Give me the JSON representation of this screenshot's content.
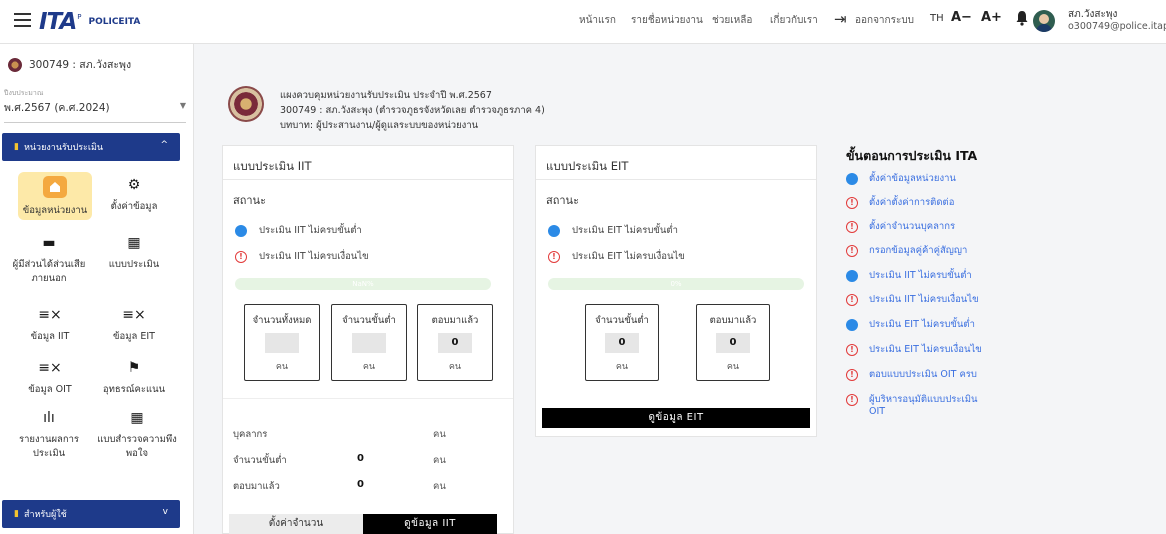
{
  "header": {
    "logo_mark": "ITA",
    "logo_reg": "P",
    "logo_text": "POLICEITA",
    "nav": [
      "หน้าแรก",
      "รายชื่อหน่วยงาน",
      "ช่วยเหลือ",
      "เกี่ยวกับเรา"
    ],
    "logout_label": "ออกจากระบบ",
    "logout_icon": "logout-icon",
    "lang": "TH",
    "font_decrease": "A−",
    "font_increase": "A+",
    "user_name": "สภ.วังสะพุง",
    "user_email": "o300749@police.itap"
  },
  "sidebar": {
    "org": "300749 : สภ.วังสะพุง",
    "year_label": "ปีงบประมาณ",
    "year_value": "พ.ศ.2567 (ค.ศ.2024)",
    "section1": "หน่วยงานรับประเมิน",
    "section2": "สำหรับผู้ใช้",
    "items": [
      {
        "label": "ข้อมูลหน่วยงาน",
        "icon": "home-icon"
      },
      {
        "label": "ตั้งค่าข้อมูล",
        "icon": "settings-icon"
      },
      {
        "label": "ผู้มีส่วนได้ส่วนเสียภายนอก",
        "icon": "store-icon"
      },
      {
        "label": "แบบประเมิน",
        "icon": "qr-icon"
      },
      {
        "label": "ข้อมูล IIT",
        "icon": "list-x-icon"
      },
      {
        "label": "ข้อมูล EIT",
        "icon": "list-x-icon"
      },
      {
        "label": "ข้อมูล OIT",
        "icon": "list-x-icon"
      },
      {
        "label": "อุทธรณ์คะแนน",
        "icon": "flag-icon"
      },
      {
        "label": "รายงานผลการประเมิน",
        "icon": "bar-chart-icon"
      },
      {
        "label": "แบบสำรวจความพึงพอใจ",
        "icon": "qr-icon"
      }
    ]
  },
  "page_header": {
    "line1": "แผงควบคุมหน่วยงานรับประเมิน ประจำปี พ.ศ.2567",
    "line2": "300749 : สภ.วังสะพุง (ตำรวจภูธรจังหวัดเลย ตำรวจภูธรภาค 4)",
    "line3": "บทบาท: ผู้ประสานงาน/ผู้ดูแลระบบของหน่วยงาน"
  },
  "iit": {
    "title": "แบบประเมิน IIT",
    "status_label": "สถานะ",
    "status1": "ประเมิน IIT ไม่ครบขั้นต่ำ",
    "status2": "ประเมิน IIT ไม่ครบเงื่อนไข",
    "progress_text": "NaN%",
    "progress": 0,
    "boxes": [
      {
        "title": "จำนวนทั้งหมด",
        "value": "",
        "unit": "คน"
      },
      {
        "title": "จำนวนขั้นต่ำ",
        "value": "",
        "unit": "คน"
      },
      {
        "title": "ตอบมาแล้ว",
        "value": "0",
        "unit": "คน"
      }
    ],
    "summary": [
      {
        "label": "บุคลากร",
        "value": "",
        "unit": "คน"
      },
      {
        "label": "จำนวนขั้นต่ำ",
        "value": "0",
        "unit": "คน"
      },
      {
        "label": "ตอบมาแล้ว",
        "value": "0",
        "unit": "คน"
      }
    ],
    "btn_set": "ตั้งค่าจำนวน",
    "btn_view": "ดูข้อมูล IIT"
  },
  "eit": {
    "title": "แบบประเมิน EIT",
    "status_label": "สถานะ",
    "status1": "ประเมิน EIT ไม่ครบขั้นต่ำ",
    "status2": "ประเมิน EIT ไม่ครบเงื่อนไข",
    "progress_text": "0%",
    "progress": 0,
    "boxes": [
      {
        "title": "จำนวนขั้นต่ำ",
        "value": "0",
        "unit": "คน"
      },
      {
        "title": "ตอบมาแล้ว",
        "value": "0",
        "unit": "คน"
      }
    ],
    "btn_view": "ดูข้อมูล EIT"
  },
  "steps": {
    "title": "ขั้นตอนการประเมิน ITA",
    "items": [
      {
        "label": "ตั้งค่าข้อมูลหน่วยงาน",
        "state": "done"
      },
      {
        "label": "ตั้งค่าตั้งค่าการติดต่อ",
        "state": "warn"
      },
      {
        "label": "ตั้งค่าจำนวนบุคลากร",
        "state": "warn"
      },
      {
        "label": "กรอกข้อมูลคู่ค้าคู่สัญญา",
        "state": "warn"
      },
      {
        "label": "ประเมิน IIT ไม่ครบขั้นต่ำ",
        "state": "done"
      },
      {
        "label": "ประเมิน IIT ไม่ครบเงื่อนไข",
        "state": "warn"
      },
      {
        "label": "ประเมิน EIT ไม่ครบขั้นต่ำ",
        "state": "done"
      },
      {
        "label": "ประเมิน EIT ไม่ครบเงื่อนไข",
        "state": "warn"
      },
      {
        "label": "ตอบแบบประเมิน OIT ครบ",
        "state": "warn"
      },
      {
        "label": "ผู้บริหารอนุมัติแบบประเมิน OIT",
        "state": "warn"
      }
    ]
  },
  "colors": {
    "brand": "#1e3a8a",
    "done": "#2b8ae6",
    "warn": "#e23a3a",
    "link": "#3a6fe0"
  }
}
